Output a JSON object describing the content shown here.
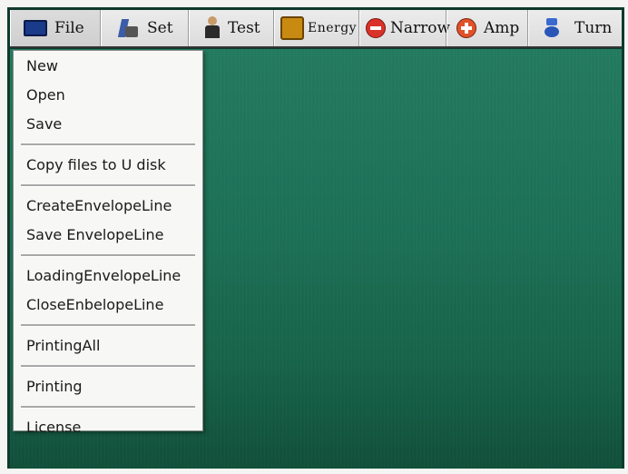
{
  "menubar": {
    "items": [
      {
        "label": "File",
        "icon": "monitor-icon"
      },
      {
        "label": "Set",
        "icon": "settings-icon"
      },
      {
        "label": "Test",
        "icon": "person-icon"
      },
      {
        "label": "Energy",
        "icon": "energy-book-icon"
      },
      {
        "label": "Narrow",
        "icon": "minus-circle-icon"
      },
      {
        "label": "Amp",
        "icon": "plus-circle-icon"
      },
      {
        "label": "Turn",
        "icon": "turn-icon"
      }
    ]
  },
  "file_menu": {
    "items": [
      "New",
      "Open",
      "Save",
      "Copy files to U disk",
      "CreateEnvelopeLine",
      "Save EnvelopeLine",
      "LoadingEnvelopeLine",
      "CloseEnbelopeLine",
      "PrintingAll",
      "Printing",
      "License"
    ]
  },
  "colors": {
    "desktop": "#1c6f55",
    "menubar": "#dcdcdc",
    "dropdown": "#f7f7f5"
  }
}
